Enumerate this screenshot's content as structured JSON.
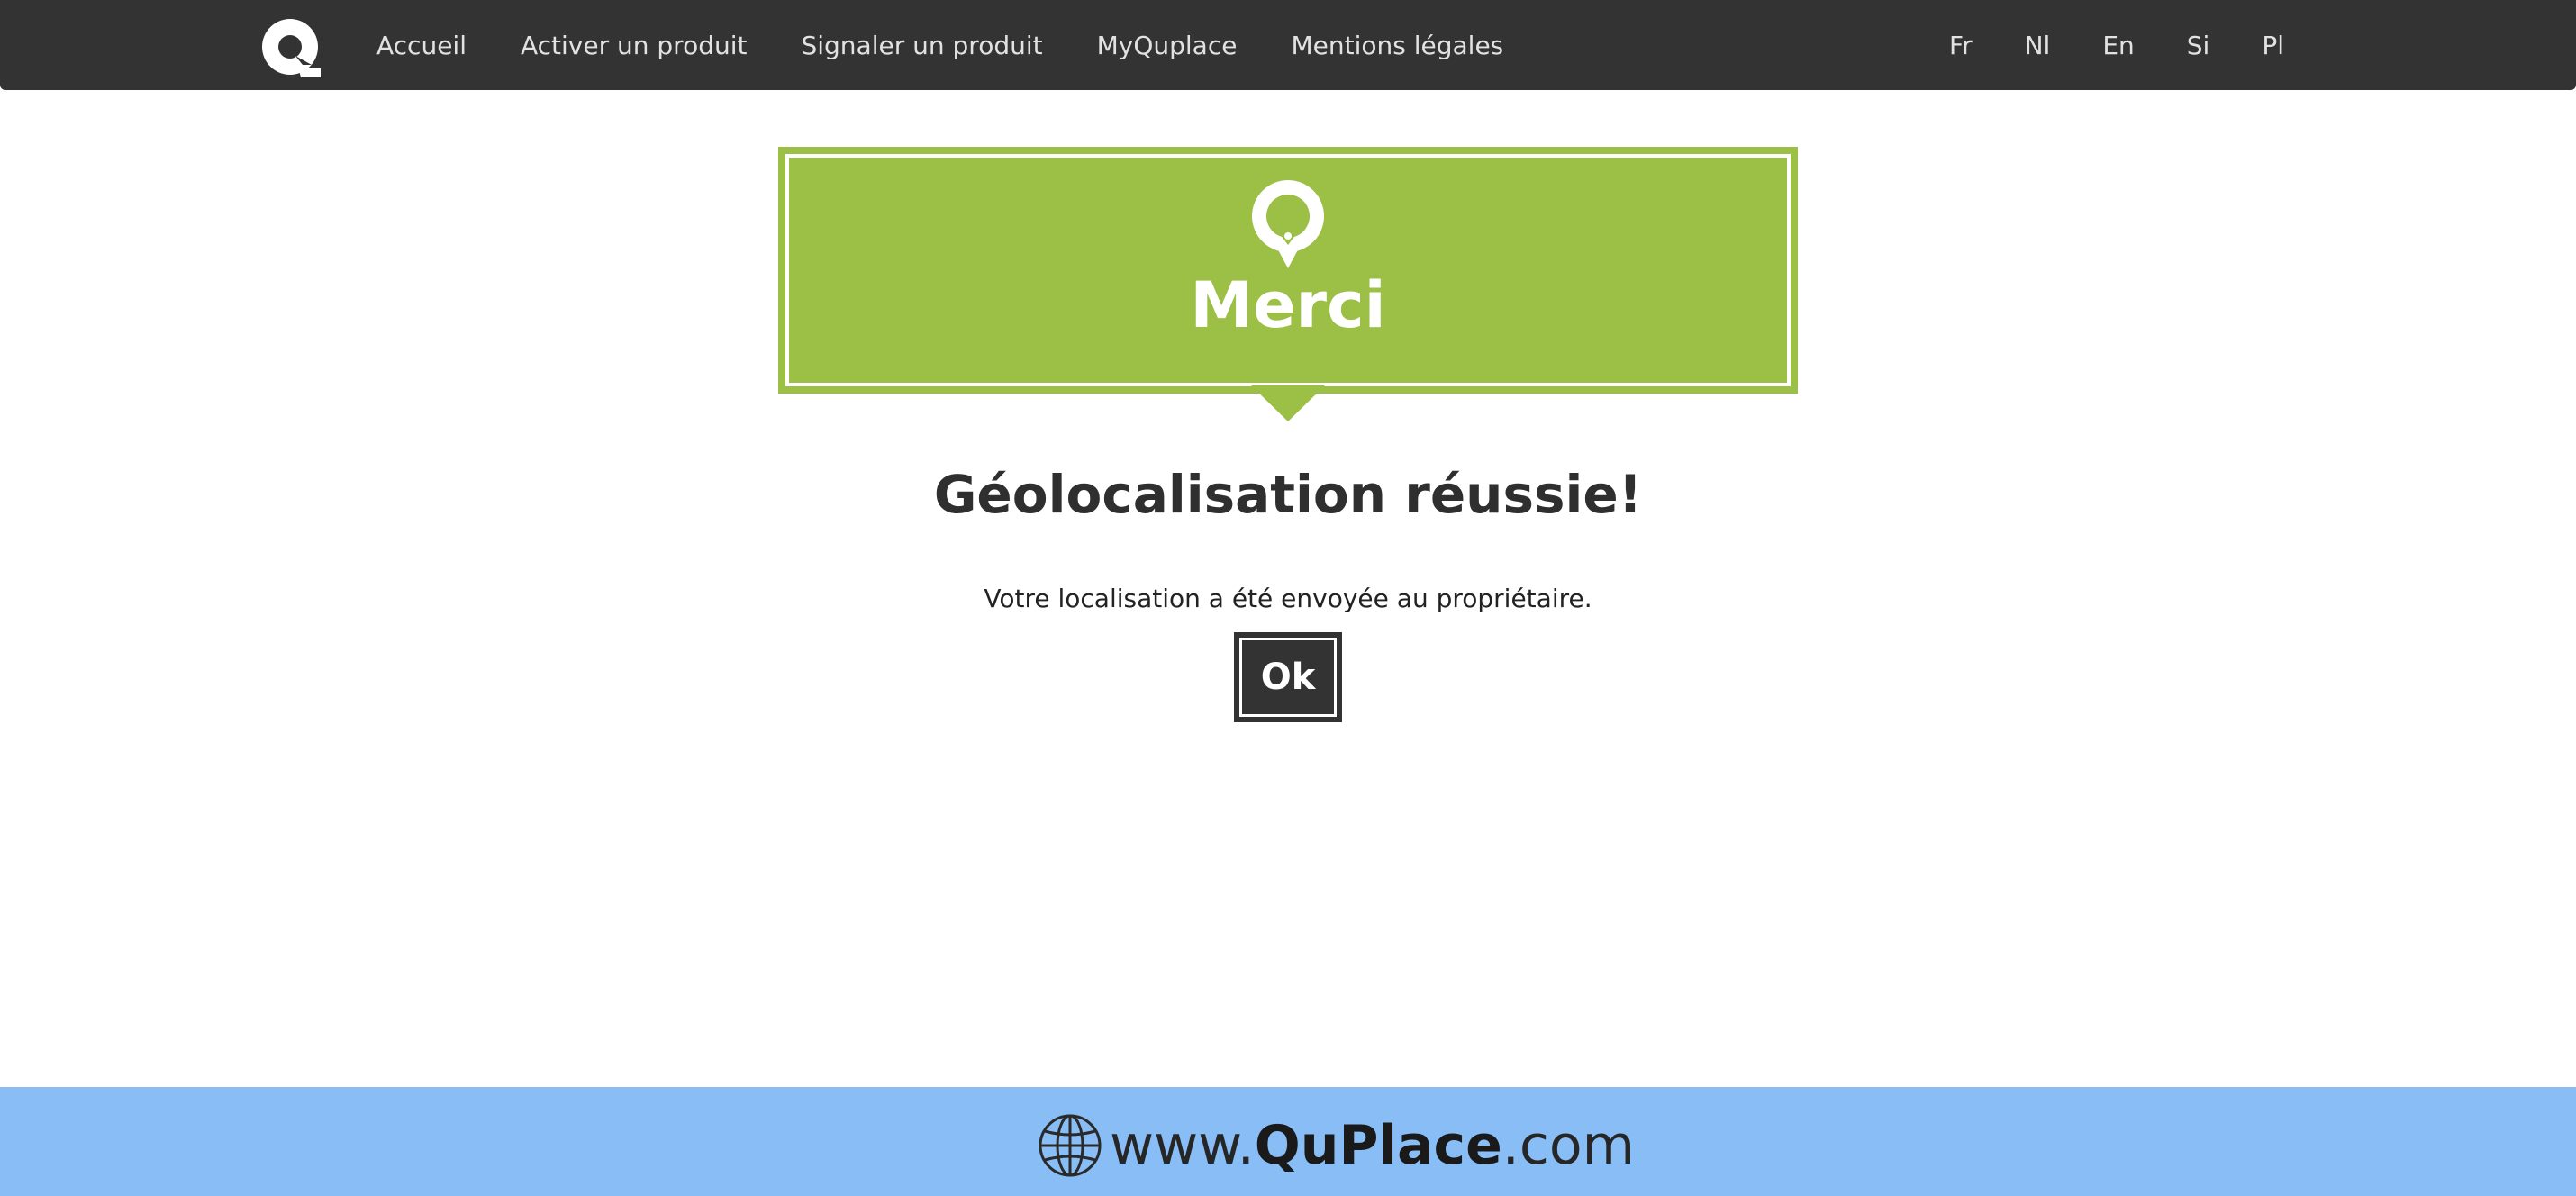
{
  "nav": {
    "logo_icon": "quplace-logo-icon",
    "links": [
      "Accueil",
      "Activer un produit",
      "Signaler un produit",
      "MyQuplace",
      "Mentions légales"
    ],
    "languages": [
      "Fr",
      "Nl",
      "En",
      "Si",
      "Pl"
    ]
  },
  "banner": {
    "icon": "location-pin-icon",
    "title": "Merci",
    "color": "#9cbf45"
  },
  "content": {
    "heading": "Géolocalisation réussie!",
    "message": "Votre localisation a été envoyée au propriétaire.",
    "ok_label": "Ok"
  },
  "footer": {
    "icon": "globe-icon",
    "url_prefix": "www.",
    "url_brand": "QuPlace",
    "url_suffix": ".com",
    "color": "#88bef5"
  }
}
